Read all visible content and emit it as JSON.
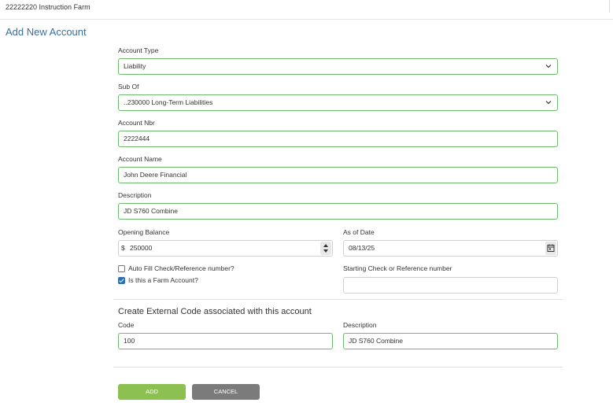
{
  "header": {
    "farm_name": "22222220 Instruction Farm"
  },
  "page": {
    "title": "Add New Account"
  },
  "form": {
    "account_type": {
      "label": "Account Type",
      "value": "Liability"
    },
    "sub_of": {
      "label": "Sub Of",
      "value": "..230000 Long-Term Liabilities"
    },
    "account_nbr": {
      "label": "Account Nbr",
      "value": "2222444"
    },
    "account_name": {
      "label": "Account Name",
      "value": "John Deere Financial"
    },
    "description": {
      "label": "Description",
      "value": "JD S760 Combine"
    },
    "opening_balance": {
      "label": "Opening Balance",
      "currency": "$",
      "value": "250000"
    },
    "as_of_date": {
      "label": "As of Date",
      "value": "08/13/25"
    },
    "auto_fill": {
      "label": "Auto Fill Check/Reference number?",
      "checked": false
    },
    "farm_account": {
      "label": "Is this a Farm Account?",
      "checked": true
    },
    "starting_check": {
      "label": "Starting Check or Reference number",
      "value": ""
    }
  },
  "external_code": {
    "title": "Create External Code associated with this account",
    "code": {
      "label": "Code",
      "value": "100"
    },
    "description": {
      "label": "Description",
      "value": "JD S760 Combine"
    }
  },
  "actions": {
    "add_label": "ADD",
    "cancel_label": "CANCEL"
  },
  "colors": {
    "accent": "#3b6e99",
    "field_border": "#6dbb6d",
    "add_button": "#8cc152",
    "cancel_button": "#7b7b7b"
  }
}
